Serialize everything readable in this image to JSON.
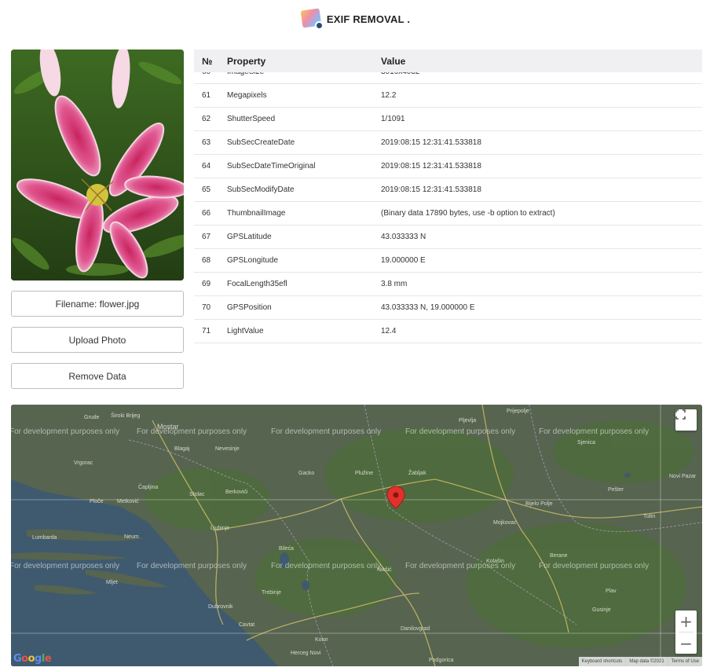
{
  "header": {
    "title": "EXIF REMOVAL ."
  },
  "left": {
    "filename_label": "Filename: flower.jpg",
    "upload_label": "Upload Photo",
    "remove_label": "Remove Data"
  },
  "table": {
    "headers": [
      "№",
      "Property",
      "Value"
    ],
    "rows": [
      {
        "n": "60",
        "property": "ImageSize",
        "value": "3016x4032"
      },
      {
        "n": "61",
        "property": "Megapixels",
        "value": "12.2"
      },
      {
        "n": "62",
        "property": "ShutterSpeed",
        "value": "1/1091"
      },
      {
        "n": "63",
        "property": "SubSecCreateDate",
        "value": "2019:08:15 12:31:41.533818"
      },
      {
        "n": "64",
        "property": "SubSecDateTimeOriginal",
        "value": "2019:08:15 12:31:41.533818"
      },
      {
        "n": "65",
        "property": "SubSecModifyDate",
        "value": "2019:08:15 12:31:41.533818"
      },
      {
        "n": "66",
        "property": "ThumbnailImage",
        "value": "(Binary data 17890 bytes, use -b option to extract)"
      },
      {
        "n": "67",
        "property": "GPSLatitude",
        "value": "43.033333 N"
      },
      {
        "n": "68",
        "property": "GPSLongitude",
        "value": "19.000000 E"
      },
      {
        "n": "69",
        "property": "FocalLength35efl",
        "value": "3.8 mm"
      },
      {
        "n": "70",
        "property": "GPSPosition",
        "value": "43.033333 N, 19.000000 E"
      },
      {
        "n": "71",
        "property": "LightValue",
        "value": "12.4"
      }
    ]
  },
  "map": {
    "watermark": "For development purposes only",
    "places": [
      "Mostar",
      "Grude",
      "Široki Brijeg",
      "Blagaj",
      "Nevesinje",
      "Vrgorac",
      "Čapljina",
      "Stolac",
      "Berkovići",
      "Gacko",
      "Plužine",
      "Žabljak",
      "Pljevlja",
      "Prijepolje",
      "Metković",
      "Ploče",
      "Neum",
      "Ljubinje",
      "Bileća",
      "Trebinje",
      "Dubrovnik",
      "Nikšić",
      "Kolašin",
      "Berane",
      "Bijelo Polje",
      "Mojkovac",
      "Danilovgrad",
      "Podgorica",
      "Herceg Novi",
      "Tutin",
      "Novi Pazar",
      "Sjenica",
      "Pešter",
      "Lumbarda",
      "Mljet",
      "Cavtat",
      "Plav",
      "Gusinje",
      "Kotor"
    ],
    "google_logo": "Google",
    "attribution": [
      "Keyboard shortcuts",
      "Map data ©2021",
      "Terms of Use"
    ]
  }
}
